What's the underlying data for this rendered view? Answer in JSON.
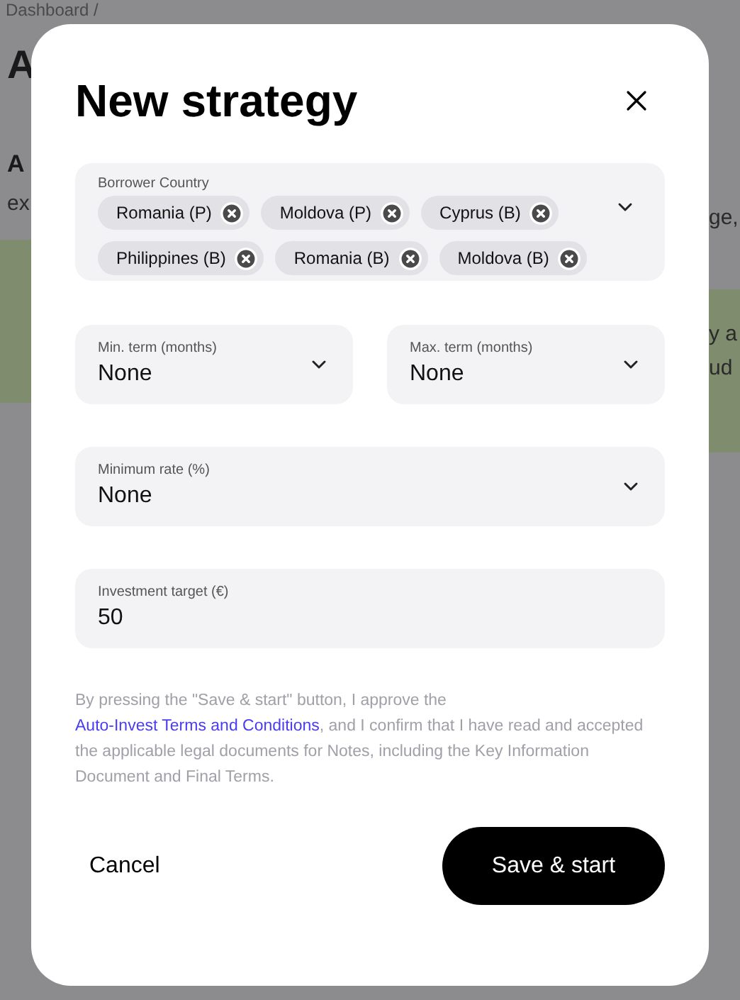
{
  "background": {
    "breadcrumb": "Dashboard /",
    "heading": "A",
    "subheading": "A",
    "left_text": "ex",
    "right_texts": [
      "ge,",
      "y a",
      "ud"
    ]
  },
  "dialog": {
    "title": "New strategy",
    "borrower_country": {
      "label": "Borrower Country",
      "chips": [
        "Romania (P)",
        "Moldova (P)",
        "Cyprus (B)",
        "Philippines (B)",
        "Romania (B)",
        "Moldova (B)"
      ]
    },
    "term_fields": [
      {
        "label": "Min. term (months)",
        "value": "None"
      },
      {
        "label": "Max. term (months)",
        "value": "None"
      }
    ],
    "minimum_rate": {
      "label": "Minimum rate (%)",
      "value": "None"
    },
    "investment_target": {
      "label": "Investment target (€)",
      "value": "50"
    },
    "disclaimer": {
      "before": "By pressing the \"Save & start\" button, I approve the ",
      "link": "Auto-Invest Terms and Conditions",
      "after": ", and I confirm that I have read and accepted the applicable legal documents for Notes, including the Key Information Document and Final Terms."
    },
    "cancel": "Cancel",
    "submit": "Save & start"
  }
}
